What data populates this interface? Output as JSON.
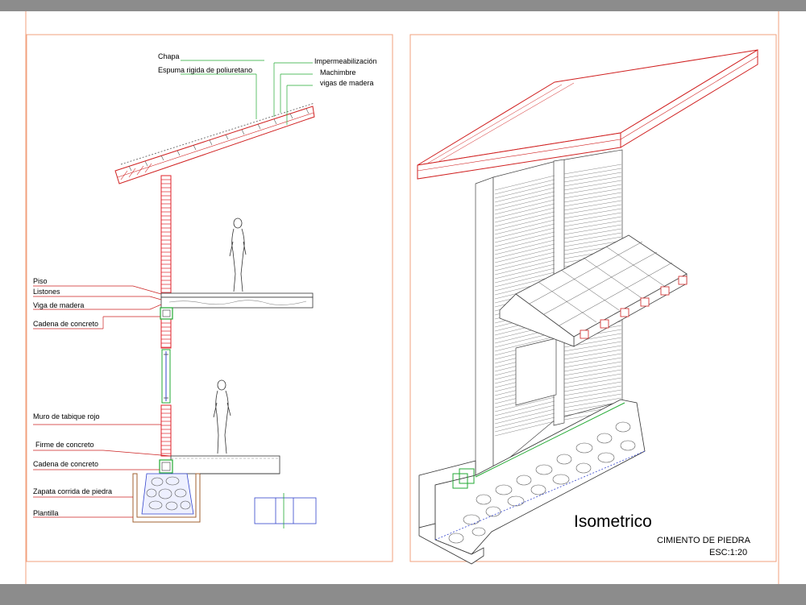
{
  "section_labels": {
    "chapa": "Chapa",
    "espuma": "Espuma rigida de poliuretano",
    "impermeabilizacion": "Impermeabilización",
    "machimbre": "Machimbre",
    "vigas": "vigas de madera",
    "piso": "Piso",
    "listones": "Listones",
    "viga": "Viga de madera",
    "cadena_sup": "Cadena de concreto",
    "muro": "Muro de tabique rojo",
    "firme": "Firme de concreto",
    "cadena_inf": "Cadena de concreto",
    "zapata": "Zapata corrida de piedra",
    "plantilla": "Plantilla"
  },
  "isometric": {
    "title": "Isometrico",
    "subtitle": "CIMIENTO DE PIEDRA",
    "scale": "ESC:1:20"
  },
  "colors": {
    "frame": "#f2a07e",
    "brick": "#e0202a",
    "leader": "#cc2222",
    "green": "#22aa33",
    "blue": "#3344cc",
    "line": "#333333"
  }
}
